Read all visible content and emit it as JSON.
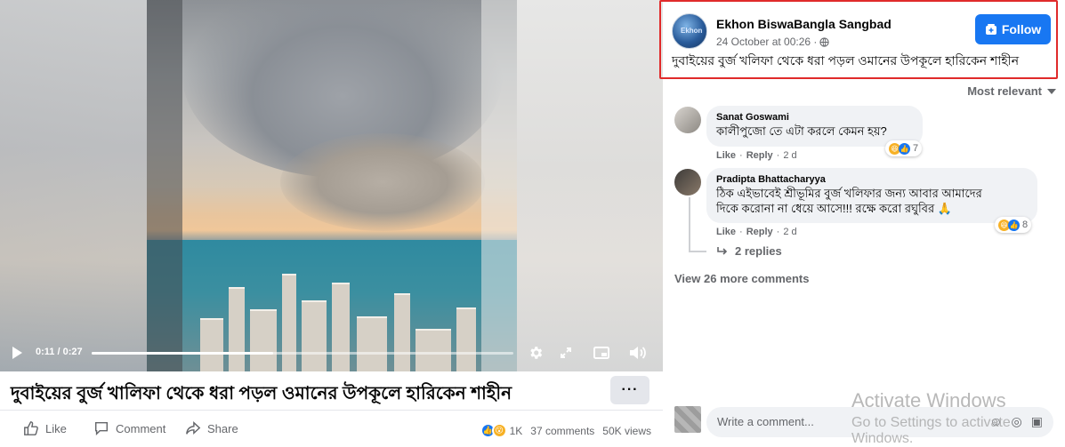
{
  "video": {
    "time": "0:11 / 0:27",
    "progress": 0.43,
    "title": "দুবাইয়ের বুর্জ খালিফা থেকে ধরা পড়ল ওমানের উপকূলে হারিকেন শাহীন",
    "more_label": "···"
  },
  "actions": {
    "like": "Like",
    "comment": "Comment",
    "share": "Share"
  },
  "stats": {
    "reactions": "1K",
    "comments": "37 comments",
    "views": "50K views"
  },
  "post": {
    "page_name": "Ekhon BiswaBangla Sangbad",
    "avatar_text": "Ekhon",
    "timestamp": "24 October at 00:26 ·",
    "follow_label": "Follow",
    "text": "দুবাইয়ের বুর্জ খলিফা থেকে ধরা পড়ল ওমানের উপকূলে হারিকেন শাহীন"
  },
  "sort_label": "Most relevant",
  "comments": [
    {
      "author": "Sanat Goswami",
      "text": "কালীপুজো তে এটা করলে কেমন হয়?",
      "like": "Like",
      "reply": "Reply",
      "age": "2 d",
      "reaction_count": "7"
    },
    {
      "author": "Pradipta Bhattacharyya",
      "text_line1": "ঠিক এইভাবেই শ্রীভূমির বুর্জ খলিফার জন্য আবার আমাদের",
      "text_line2": "দিকে করোনা না ধেয়ে আসে!!! রক্ষে করো রঘুবির 🙏",
      "like": "Like",
      "reply": "Reply",
      "age": "2 d",
      "reaction_count": "8"
    }
  ],
  "replies_label": "2 replies",
  "view_more_label": "View 26 more comments",
  "write_placeholder": "Write a comment...",
  "watermark": {
    "line1": "Activate Windows",
    "line2": "Go to Settings to activate Windows."
  },
  "colors": {
    "accent": "#1877f2",
    "highlight_border": "#e02a2a",
    "muted_text": "#65676b",
    "bubble_bg": "#f0f2f5"
  }
}
